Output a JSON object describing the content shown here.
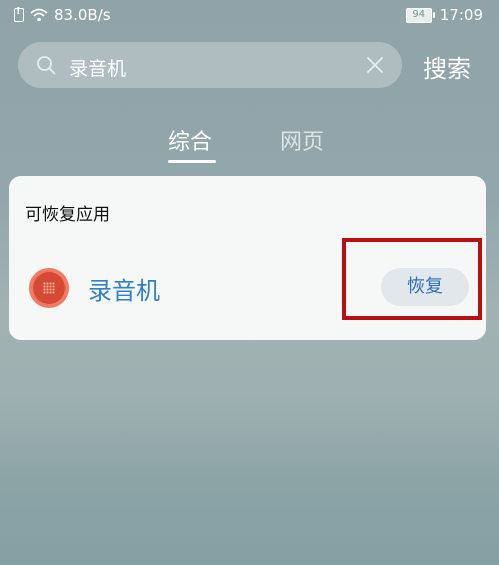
{
  "status_bar": {
    "network_speed": "83.0B/s",
    "battery_level": "94",
    "time": "17:09"
  },
  "search": {
    "query": "录音机",
    "submit_label": "搜索"
  },
  "tabs": [
    {
      "label": "综合",
      "active": true
    },
    {
      "label": "网页",
      "active": false
    }
  ],
  "card": {
    "title": "可恢复应用",
    "app": {
      "name": "录音机",
      "action_label": "恢复"
    }
  },
  "colors": {
    "accent_blue": "#2f7fd0",
    "highlight_red": "#b80f13"
  }
}
